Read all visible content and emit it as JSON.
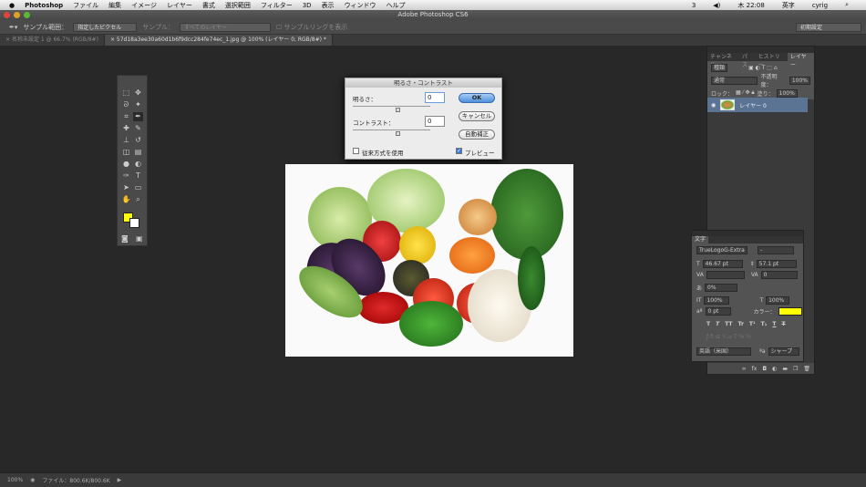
{
  "menubar": {
    "apple": "",
    "items": [
      "Photoshop",
      "ファイル",
      "編集",
      "イメージ",
      "レイヤー",
      "書式",
      "選択範囲",
      "フィルター",
      "3D",
      "表示",
      "ウィンドウ",
      "ヘルプ"
    ],
    "status": [
      "3",
      "木 22:08",
      "英字",
      "cyrig"
    ]
  },
  "title": "Adobe Photoshop CS6",
  "options": {
    "sample_size_label": "サンプル範囲：",
    "sample_size": "指定したピクセル",
    "sample_label": "サンプル：",
    "sample": "すべてのレイヤー",
    "show_ring": "サンプルリングを表示",
    "workspace": "初期設定"
  },
  "tabs": [
    "名称未設定 1 @ 66.7% (RGB/8#)",
    "57d18a3ee30a60d1b6f9dcc284fe74ec_1.jpg @ 100% (レイヤー 0, RGB/8#) *"
  ],
  "dialog": {
    "title": "明るさ・コントラスト",
    "brightness_label": "明るさ：",
    "brightness": "0",
    "contrast_label": "コントラスト：",
    "contrast": "0",
    "ok": "OK",
    "cancel": "キャンセル",
    "auto": "自動補正",
    "legacy": "従来方式を使用",
    "preview": "プレビュー",
    "legacy_checked": false,
    "preview_checked": true
  },
  "layers": {
    "tabs": [
      "チャンネル",
      "パス",
      "ヒストリー",
      "レイヤー"
    ],
    "filter": "種類",
    "blend": "通常",
    "opacity_label": "不透明度：",
    "opacity": "100%",
    "lock_label": "ロック：",
    "fill_label": "塗り：",
    "fill": "100%",
    "layer_name": "レイヤー 0"
  },
  "character": {
    "title": "文字",
    "font": "TrueLogoG-Extra",
    "style": "-",
    "size": "46.67 pt",
    "leading": "57.1 pt",
    "tracking": "0",
    "kerning": "0%",
    "vscale": "100%",
    "hscale": "100%",
    "baseline": "0 pt",
    "color_label": "カラー：",
    "color": "#ffff00",
    "language": "英語（米国）",
    "aa": "シャープ",
    "styles": [
      "T",
      "T",
      "TT",
      "Tr",
      "T¹",
      "T₁",
      "T",
      "Ŧ"
    ]
  },
  "status": {
    "zoom": "100%",
    "doc": "ファイル：800.6K/800.6K"
  }
}
